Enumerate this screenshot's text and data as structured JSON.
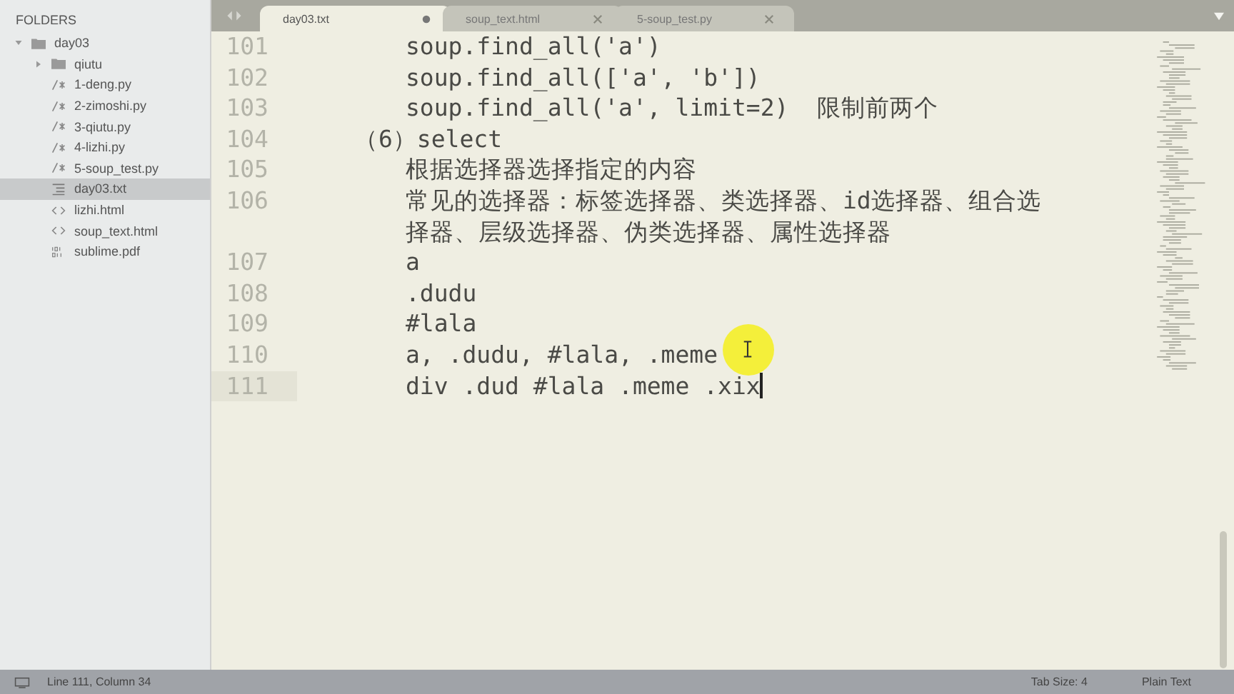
{
  "sidebar": {
    "header": "FOLDERS",
    "tree": [
      {
        "label": "day03",
        "kind": "folder",
        "expanded": true,
        "selected": false,
        "children": [
          {
            "label": "qiutu",
            "kind": "folder",
            "expanded": false,
            "selected": false
          },
          {
            "label": "1-deng.py",
            "kind": "code",
            "selected": false
          },
          {
            "label": "2-zimoshi.py",
            "kind": "code",
            "selected": false
          },
          {
            "label": "3-qiutu.py",
            "kind": "code",
            "selected": false
          },
          {
            "label": "4-lizhi.py",
            "kind": "code",
            "selected": false
          },
          {
            "label": "5-soup_test.py",
            "kind": "code",
            "selected": false
          },
          {
            "label": "day03.txt",
            "kind": "text",
            "selected": true
          },
          {
            "label": "lizhi.html",
            "kind": "markup",
            "selected": false
          },
          {
            "label": "soup_text.html",
            "kind": "markup",
            "selected": false
          },
          {
            "label": "sublime.pdf",
            "kind": "binary",
            "selected": false
          }
        ]
      }
    ]
  },
  "tabs": [
    {
      "label": "day03.txt",
      "selected": true,
      "modified": true
    },
    {
      "label": "soup_text.html",
      "selected": false,
      "modified": false
    },
    {
      "label": "5-soup_test.py",
      "selected": false,
      "modified": false
    }
  ],
  "editor": {
    "lines": [
      {
        "number": "101",
        "kind": "item",
        "text": "soup.find_all('a')",
        "current": false
      },
      {
        "number": "102",
        "kind": "item",
        "text": "soup.find_all(['a', 'b'])",
        "current": false
      },
      {
        "number": "103",
        "kind": "item",
        "text": "soup.find_all('a', limit=2)  限制前两个",
        "current": false
      },
      {
        "number": "104",
        "kind": "heading",
        "text": "（6）select",
        "current": false
      },
      {
        "number": "105",
        "kind": "item",
        "text": "根据选择器选择指定的内容",
        "current": false
      },
      {
        "number": "106",
        "kind": "item",
        "text": "常见的选择器：标签选择器、类选择器、id选择器、组合选择器、层级选择器、伪类选择器、属性选择器",
        "current": false
      },
      {
        "number": "107",
        "kind": "item",
        "text": "a",
        "current": false
      },
      {
        "number": "108",
        "kind": "item",
        "text": ".dudu",
        "current": false
      },
      {
        "number": "109",
        "kind": "item",
        "text": "#lala",
        "current": false
      },
      {
        "number": "110",
        "kind": "item",
        "text": "a, .dudu, #lala, .meme",
        "current": false
      },
      {
        "number": "111",
        "kind": "item",
        "text": "div .dud #lala .meme .xix",
        "current": true
      }
    ]
  },
  "status_bar": {
    "position": "Line 111, Column 34",
    "tab_size": "Tab Size: 4",
    "syntax": "Plain Text"
  }
}
